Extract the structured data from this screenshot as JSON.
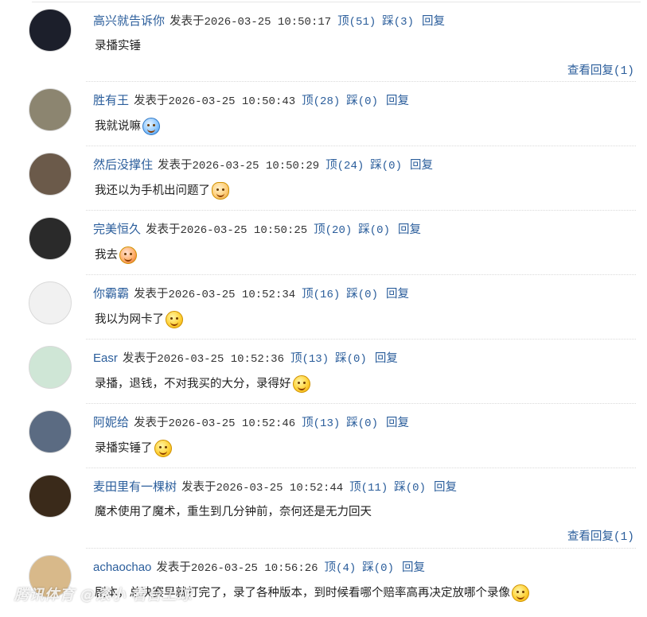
{
  "labels": {
    "posted": "发表于",
    "up": "顶",
    "down": "踩",
    "reply": "回复",
    "show_replies": "查看回复"
  },
  "comments": [
    {
      "user": "高兴就告诉你",
      "time": "2026-03-25 10:50:17",
      "up": "(51)",
      "down": "(3)",
      "text": "录播实锤",
      "emoji": "",
      "show_replies": "(1)",
      "avatar_bg": "#1c1f2b"
    },
    {
      "user": "胜有王",
      "time": "2026-03-25 10:50:43",
      "up": "(28)",
      "down": "(0)",
      "text": "我就说嘛",
      "emoji": "blue",
      "show_replies": "",
      "avatar_bg": "#8c8570"
    },
    {
      "user": "然后没撑住",
      "time": "2026-03-25 10:50:29",
      "up": "(24)",
      "down": "(0)",
      "text": "我还以为手机出问题了",
      "emoji": "cat",
      "show_replies": "",
      "avatar_bg": "#6b5a4a"
    },
    {
      "user": "完美恒久",
      "time": "2026-03-25 10:50:25",
      "up": "(20)",
      "down": "(0)",
      "text": "我去",
      "emoji": "red",
      "show_replies": "",
      "avatar_bg": "#2a2a2a"
    },
    {
      "user": "你霸霸",
      "time": "2026-03-25 10:52:34",
      "up": "(16)",
      "down": "(0)",
      "text": "我以为网卡了",
      "emoji": "smile",
      "show_replies": "",
      "avatar_bg": "#f1f1f1"
    },
    {
      "user": "Easr",
      "time": "2026-03-25 10:52:36",
      "up": "(13)",
      "down": "(0)",
      "text": "录播，退钱，不对我买的大分，录得好",
      "emoji": "smile",
      "show_replies": "",
      "avatar_bg": "#cfe6d6"
    },
    {
      "user": "阿妮给",
      "time": "2026-03-25 10:52:46",
      "up": "(13)",
      "down": "(0)",
      "text": "录播实锤了",
      "emoji": "smile",
      "show_replies": "",
      "avatar_bg": "#5b6b82"
    },
    {
      "user": "麦田里有一棵树",
      "time": "2026-03-25 10:52:44",
      "up": "(11)",
      "down": "(0)",
      "text": "魔术使用了魔术，重生到几分钟前，奈何还是无力回天",
      "emoji": "",
      "show_replies": "(1)",
      "avatar_bg": "#3a2a1a"
    },
    {
      "user": "achaochao",
      "time": "2026-03-25 10:56:26",
      "up": "(4)",
      "down": "(0)",
      "text": "剧本，总决赛早就打完了，录了各种版本，到时候看哪个赔率高再决定放哪个录像",
      "emoji": "smile",
      "show_replies": "",
      "avatar_bg": "#d8b98a"
    }
  ],
  "watermark": "腾讯体育 @滚小 看台上球"
}
